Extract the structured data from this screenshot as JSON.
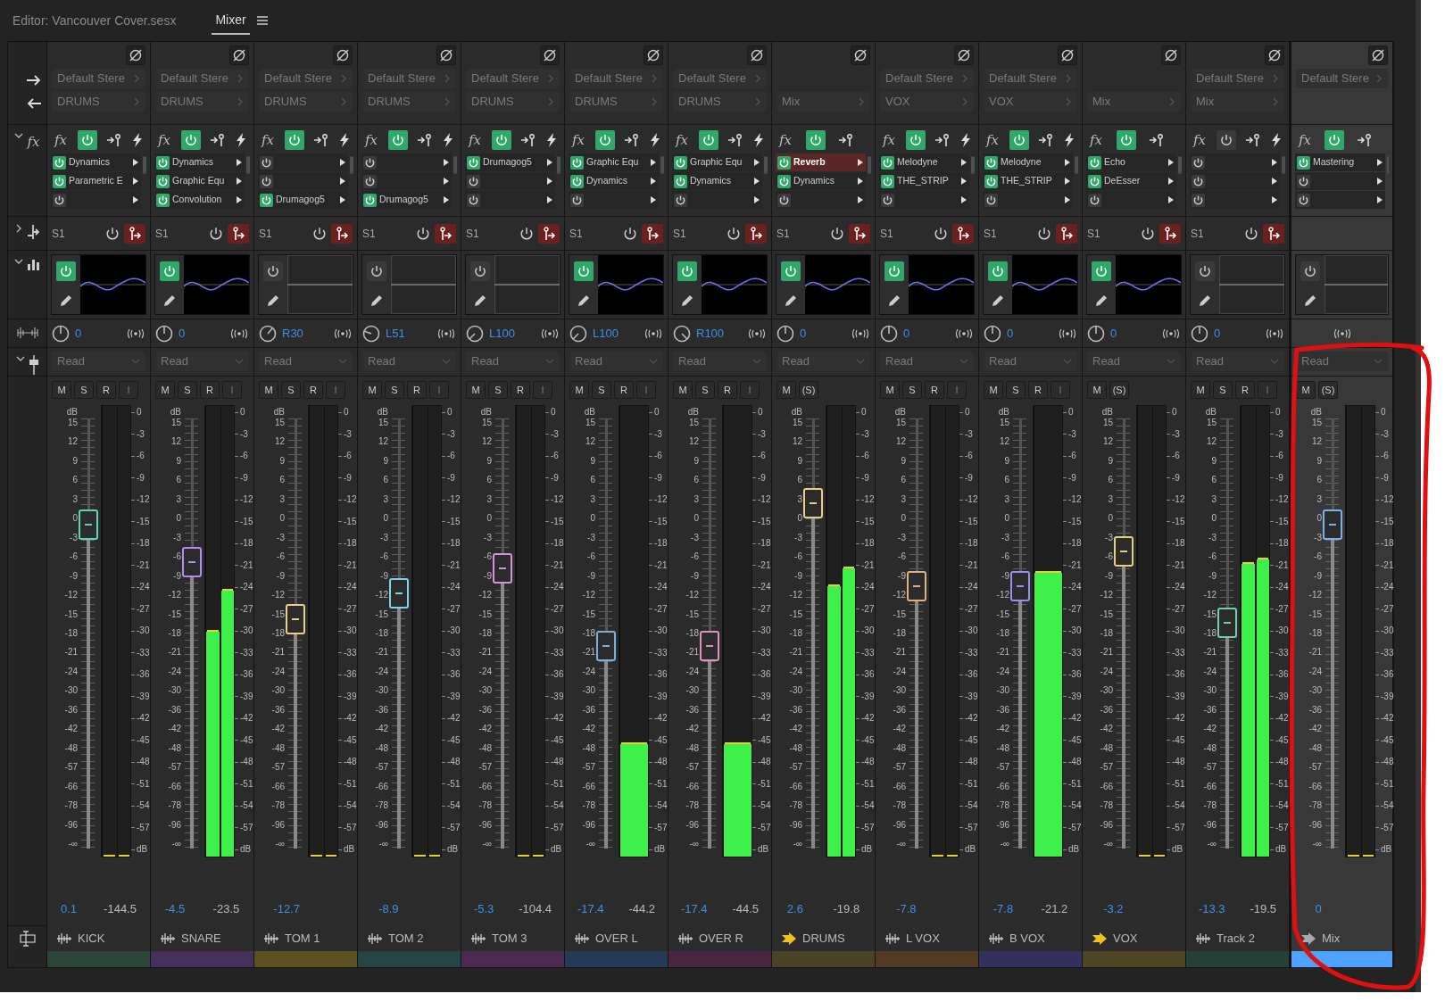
{
  "header": {
    "title": "Editor: Vancouver Cover.sesx",
    "tabs": [
      {
        "label": "Mixer",
        "selected": true
      }
    ]
  },
  "side_labels": {
    "fx": "fx"
  },
  "strips": [
    {
      "kind": "track",
      "input": "Default Stere",
      "output": "DRUMS",
      "fx_label": "fx",
      "fx_on": true,
      "fx_lightning": true,
      "fx": [
        {
          "name": "Dynamics",
          "on": true,
          "selected": false
        },
        {
          "name": "Parametric E",
          "on": true,
          "selected": false
        },
        {
          "on": false,
          "selected": false
        }
      ],
      "send": "S1",
      "eq_on": true,
      "pan": {
        "value": "0",
        "kind": "center"
      },
      "automation": "Read",
      "buttons": [
        {
          "label": "M",
          "disabled": false
        },
        {
          "label": "S",
          "disabled": false
        },
        {
          "label": "R",
          "disabled": false
        },
        {
          "label": "I",
          "disabled": true
        }
      ],
      "fader_scale": [
        "15",
        "12",
        "9",
        "6",
        "3",
        "0",
        "-3",
        "-6",
        "-9",
        "-12",
        "-15",
        "-18",
        "-21",
        "-24",
        "-30",
        "-36",
        "-42",
        "-48",
        "-57",
        "-66",
        "-78",
        "-96",
        "-∞"
      ],
      "fader_unit": "dB",
      "meter_unit": "dB",
      "fader": {
        "level": 0.754,
        "color": "#5fd3b5"
      },
      "meters": [
        {
          "level": 0
        },
        {
          "level": 0
        }
      ],
      "meter_scale": [
        "0",
        "-3",
        "-6",
        "-9",
        "-12",
        "-15",
        "-18",
        "-21",
        "-24",
        "-27",
        "-30",
        "-33",
        "-36",
        "-39",
        "-42",
        "-45",
        "-48",
        "-51",
        "-54",
        "-57"
      ],
      "volume": "0.1",
      "peak": "-144.5",
      "name": "KICK",
      "color": "#2c4538"
    },
    {
      "kind": "track",
      "input": "Default Stere",
      "output": "DRUMS",
      "fx_label": "fx",
      "fx_on": true,
      "fx_lightning": true,
      "fx": [
        {
          "name": "Dynamics",
          "on": true,
          "selected": false
        },
        {
          "name": "Graphic Equ",
          "on": true,
          "selected": false
        },
        {
          "name": "Convolution",
          "on": true,
          "selected": false
        }
      ],
      "send": "S1",
      "eq_on": true,
      "pan": {
        "value": "0",
        "kind": "center"
      },
      "automation": "Read",
      "buttons": [
        {
          "label": "M",
          "disabled": false
        },
        {
          "label": "S",
          "disabled": false
        },
        {
          "label": "R",
          "disabled": false
        },
        {
          "label": "I",
          "disabled": true
        }
      ],
      "fader_scale": [
        "15",
        "12",
        "9",
        "6",
        "3",
        "0",
        "-3",
        "-6",
        "-9",
        "-12",
        "-15",
        "-18",
        "-21",
        "-24",
        "-30",
        "-36",
        "-42",
        "-48",
        "-57",
        "-66",
        "-78",
        "-96",
        "-∞"
      ],
      "fader_unit": "dB",
      "meter_unit": "dB",
      "fader": {
        "level": 0.666,
        "color": "#b48cf0"
      },
      "meters": [
        {
          "level": 0.5
        },
        {
          "level": 0.59
        }
      ],
      "meter_scale": [
        "0",
        "-3",
        "-6",
        "-9",
        "-12",
        "-15",
        "-18",
        "-21",
        "-24",
        "-27",
        "-30",
        "-33",
        "-36",
        "-39",
        "-42",
        "-45",
        "-48",
        "-51",
        "-54",
        "-57"
      ],
      "volume": "-4.5",
      "peak": "-23.5",
      "name": "SNARE",
      "color": "#44305a"
    },
    {
      "kind": "track",
      "input": "Default Stere",
      "output": "DRUMS",
      "fx_label": "fx",
      "fx_on": true,
      "fx_lightning": true,
      "fx": [
        {
          "on": false,
          "selected": false
        },
        {
          "on": false,
          "selected": false
        },
        {
          "name": "Drumagog5",
          "on": true,
          "selected": false
        }
      ],
      "send": "S1",
      "eq_on": false,
      "pan": {
        "value": "R30",
        "kind": "right"
      },
      "automation": "Read",
      "buttons": [
        {
          "label": "M",
          "disabled": false
        },
        {
          "label": "S",
          "disabled": false
        },
        {
          "label": "R",
          "disabled": false
        },
        {
          "label": "I",
          "disabled": true
        }
      ],
      "fader_scale": [
        "15",
        "12",
        "9",
        "6",
        "3",
        "0",
        "-3",
        "-6",
        "-9",
        "-12",
        "-15",
        "-18",
        "-21",
        "-24",
        "-30",
        "-36",
        "-42",
        "-48",
        "-57",
        "-66",
        "-78",
        "-96",
        "-∞"
      ],
      "fader_unit": "dB",
      "meter_unit": "dB",
      "fader": {
        "level": 0.534,
        "color": "#e8d08a"
      },
      "meters": [
        {
          "level": 0
        },
        {
          "level": 0
        }
      ],
      "meter_scale": [
        "0",
        "-3",
        "-6",
        "-9",
        "-12",
        "-15",
        "-18",
        "-21",
        "-24",
        "-27",
        "-30",
        "-33",
        "-36",
        "-39",
        "-42",
        "-45",
        "-48",
        "-51",
        "-54",
        "-57"
      ],
      "volume": "-12.7",
      "name": "TOM 1",
      "color": "#5a5020"
    },
    {
      "kind": "track",
      "input": "Default Stere",
      "output": "DRUMS",
      "fx_label": "fx",
      "fx_on": true,
      "fx_lightning": true,
      "fx": [
        {
          "on": false,
          "selected": false
        },
        {
          "on": false,
          "selected": false
        },
        {
          "name": "Drumagog5",
          "on": true,
          "selected": false
        }
      ],
      "send": "S1",
      "eq_on": false,
      "pan": {
        "value": "L51",
        "kind": "left"
      },
      "automation": "Read",
      "buttons": [
        {
          "label": "M",
          "disabled": false
        },
        {
          "label": "S",
          "disabled": false
        },
        {
          "label": "R",
          "disabled": false
        },
        {
          "label": "I",
          "disabled": true
        }
      ],
      "fader_scale": [
        "15",
        "12",
        "9",
        "6",
        "3",
        "0",
        "-3",
        "-6",
        "-9",
        "-12",
        "-15",
        "-18",
        "-21",
        "-24",
        "-30",
        "-36",
        "-42",
        "-48",
        "-57",
        "-66",
        "-78",
        "-96",
        "-∞"
      ],
      "fader_unit": "dB",
      "meter_unit": "dB",
      "fader": {
        "level": 0.593,
        "color": "#7fd6e0"
      },
      "meters": [
        {
          "level": 0
        },
        {
          "level": 0
        }
      ],
      "meter_scale": [
        "0",
        "-3",
        "-6",
        "-9",
        "-12",
        "-15",
        "-18",
        "-21",
        "-24",
        "-27",
        "-30",
        "-33",
        "-36",
        "-39",
        "-42",
        "-45",
        "-48",
        "-51",
        "-54",
        "-57"
      ],
      "volume": "-8.9",
      "name": "TOM 2",
      "color": "#254545"
    },
    {
      "kind": "track",
      "input": "Default Stere",
      "output": "DRUMS",
      "fx_label": "fx",
      "fx_on": true,
      "fx_lightning": true,
      "fx": [
        {
          "name": "Drumagog5",
          "on": true,
          "selected": false
        },
        {
          "on": false,
          "selected": false
        },
        {
          "on": false,
          "selected": false
        }
      ],
      "send": "S1",
      "eq_on": false,
      "pan": {
        "value": "L100",
        "kind": "hardleft"
      },
      "automation": "Read",
      "buttons": [
        {
          "label": "M",
          "disabled": false
        },
        {
          "label": "S",
          "disabled": false
        },
        {
          "label": "R",
          "disabled": false
        },
        {
          "label": "I",
          "disabled": true
        }
      ],
      "fader_scale": [
        "15",
        "12",
        "9",
        "6",
        "3",
        "0",
        "-3",
        "-6",
        "-9",
        "-12",
        "-15",
        "-18",
        "-21",
        "-24",
        "-30",
        "-36",
        "-42",
        "-48",
        "-57",
        "-66",
        "-78",
        "-96",
        "-∞"
      ],
      "fader_unit": "dB",
      "meter_unit": "dB",
      "fader": {
        "level": 0.651,
        "color": "#d98ee0"
      },
      "meters": [
        {
          "level": 0
        },
        {
          "level": 0
        }
      ],
      "meter_scale": [
        "0",
        "-3",
        "-6",
        "-9",
        "-12",
        "-15",
        "-18",
        "-21",
        "-24",
        "-27",
        "-30",
        "-33",
        "-36",
        "-39",
        "-42",
        "-45",
        "-48",
        "-51",
        "-54",
        "-57"
      ],
      "volume": "-5.3",
      "peak": "-104.4",
      "name": "TOM 3",
      "color": "#4a2a50"
    },
    {
      "kind": "track",
      "input": "Default Stere",
      "output": "DRUMS",
      "fx_label": "fx",
      "fx_on": true,
      "fx_lightning": true,
      "fx": [
        {
          "name": "Graphic Equ",
          "on": true,
          "selected": false
        },
        {
          "name": "Dynamics",
          "on": true,
          "selected": false
        },
        {
          "on": false,
          "selected": false
        }
      ],
      "send": "S1",
      "eq_on": true,
      "pan": {
        "value": "L100",
        "kind": "hardleft"
      },
      "automation": "Read",
      "buttons": [
        {
          "label": "M",
          "disabled": false
        },
        {
          "label": "S",
          "disabled": false
        },
        {
          "label": "R",
          "disabled": false
        },
        {
          "label": "I",
          "disabled": true
        }
      ],
      "fader_scale": [
        "15",
        "12",
        "9",
        "6",
        "3",
        "0",
        "-3",
        "-6",
        "-9",
        "-12",
        "-15",
        "-18",
        "-21",
        "-24",
        "-30",
        "-36",
        "-42",
        "-48",
        "-57",
        "-66",
        "-78",
        "-96",
        "-∞"
      ],
      "fader_unit": "dB",
      "meter_unit": "dB",
      "fader": {
        "level": 0.472,
        "color": "#7aaee0"
      },
      "meters": [
        {
          "level": 0.25
        }
      ],
      "meter_scale": [
        "0",
        "-3",
        "-6",
        "-9",
        "-12",
        "-15",
        "-18",
        "-21",
        "-24",
        "-27",
        "-30",
        "-33",
        "-36",
        "-39",
        "-42",
        "-45",
        "-48",
        "-51",
        "-54",
        "-57"
      ],
      "volume": "-17.4",
      "peak": "-44.2",
      "name": "OVER L",
      "color": "#263a58"
    },
    {
      "kind": "track",
      "input": "Default Stere",
      "output": "DRUMS",
      "fx_label": "fx",
      "fx_on": true,
      "fx_lightning": true,
      "fx": [
        {
          "name": "Graphic Equ",
          "on": true,
          "selected": false
        },
        {
          "name": "Dynamics",
          "on": true,
          "selected": false
        },
        {
          "on": false,
          "selected": false
        }
      ],
      "send": "S1",
      "eq_on": true,
      "pan": {
        "value": "R100",
        "kind": "hardright"
      },
      "automation": "Read",
      "buttons": [
        {
          "label": "M",
          "disabled": false
        },
        {
          "label": "S",
          "disabled": false
        },
        {
          "label": "R",
          "disabled": false
        },
        {
          "label": "I",
          "disabled": true
        }
      ],
      "fader_scale": [
        "15",
        "12",
        "9",
        "6",
        "3",
        "0",
        "-3",
        "-6",
        "-9",
        "-12",
        "-15",
        "-18",
        "-21",
        "-24",
        "-30",
        "-36",
        "-42",
        "-48",
        "-57",
        "-66",
        "-78",
        "-96",
        "-∞"
      ],
      "fader_unit": "dB",
      "meter_unit": "dB",
      "fader": {
        "level": 0.472,
        "color": "#e090c0"
      },
      "meters": [
        {
          "level": 0.25
        }
      ],
      "meter_scale": [
        "0",
        "-3",
        "-6",
        "-9",
        "-12",
        "-15",
        "-18",
        "-21",
        "-24",
        "-27",
        "-30",
        "-33",
        "-36",
        "-39",
        "-42",
        "-45",
        "-48",
        "-51",
        "-54",
        "-57"
      ],
      "volume": "-17.4",
      "peak": "-44.5",
      "name": "OVER R",
      "color": "#4a2540"
    },
    {
      "kind": "bus",
      "output": "Mix",
      "fx_label": "fx",
      "fx_on": true,
      "fx_lightning": false,
      "fx": [
        {
          "name": "Reverb",
          "on": true,
          "selected": true
        },
        {
          "name": "Dynamics",
          "on": true,
          "selected": false
        },
        {
          "on": false,
          "selected": false
        }
      ],
      "send": "S1",
      "eq_on": true,
      "pan": {
        "value": "0",
        "kind": "center"
      },
      "automation": "Read",
      "buttons": [
        {
          "label": "M",
          "disabled": false
        },
        {
          "label": "(S)",
          "disabled": false
        }
      ],
      "fader_scale": [
        "15",
        "12",
        "9",
        "6",
        "3",
        "0",
        "-3",
        "-6",
        "-9",
        "-12",
        "-15",
        "-18",
        "-21",
        "-24",
        "-30",
        "-36",
        "-42",
        "-48",
        "-57",
        "-66",
        "-78",
        "-96",
        "-∞"
      ],
      "fader_unit": "dB",
      "meter_unit": "dB",
      "fader": {
        "level": 0.802,
        "color": "#e8d08a"
      },
      "meters": [
        {
          "level": 0.6
        },
        {
          "level": 0.64
        }
      ],
      "meter_scale": [
        "0",
        "-3",
        "-6",
        "-9",
        "-12",
        "-15",
        "-18",
        "-21",
        "-24",
        "-27",
        "-30",
        "-33",
        "-36",
        "-39",
        "-42",
        "-45",
        "-48",
        "-51",
        "-54",
        "-57"
      ],
      "volume": "2.6",
      "peak": "-19.8",
      "name": "DRUMS",
      "color": "#4a4225"
    },
    {
      "kind": "track",
      "input": "Default Stere",
      "output": "VOX",
      "fx_label": "fx",
      "fx_on": true,
      "fx_lightning": true,
      "fx": [
        {
          "name": "Melodyne",
          "on": true,
          "selected": false
        },
        {
          "name": "THE_STRIP",
          "on": true,
          "selected": false
        },
        {
          "on": false,
          "selected": false
        }
      ],
      "send": "S1",
      "eq_on": true,
      "pan": {
        "value": "0",
        "kind": "center"
      },
      "automation": "Read",
      "buttons": [
        {
          "label": "M",
          "disabled": false
        },
        {
          "label": "S",
          "disabled": false
        },
        {
          "label": "R",
          "disabled": false
        },
        {
          "label": "I",
          "disabled": true
        }
      ],
      "fader_scale": [
        "15",
        "12",
        "9",
        "6",
        "3",
        "0",
        "-3",
        "-6",
        "-9",
        "-12",
        "-15",
        "-18",
        "-21",
        "-24",
        "-30",
        "-36",
        "-42",
        "-48",
        "-57",
        "-66",
        "-78",
        "-96",
        "-∞"
      ],
      "fader_unit": "dB",
      "meter_unit": "dB",
      "fader": {
        "level": 0.61,
        "color": "#e0b080"
      },
      "meters": [
        {
          "level": 0
        },
        {
          "level": 0
        }
      ],
      "meter_scale": [
        "0",
        "-3",
        "-6",
        "-9",
        "-12",
        "-15",
        "-18",
        "-21",
        "-24",
        "-27",
        "-30",
        "-33",
        "-36",
        "-39",
        "-42",
        "-45",
        "-48",
        "-51",
        "-54",
        "-57"
      ],
      "volume": "-7.8",
      "name": "L VOX",
      "color": "#543a22"
    },
    {
      "kind": "track",
      "input": "Default Stere",
      "output": "VOX",
      "fx_label": "fx",
      "fx_on": true,
      "fx_lightning": true,
      "fx": [
        {
          "name": "Melodyne",
          "on": true,
          "selected": false
        },
        {
          "name": "THE_STRIP",
          "on": true,
          "selected": false
        },
        {
          "on": false,
          "selected": false
        }
      ],
      "send": "S1",
      "eq_on": true,
      "pan": {
        "value": "0",
        "kind": "center"
      },
      "automation": "Read",
      "buttons": [
        {
          "label": "M",
          "disabled": false
        },
        {
          "label": "S",
          "disabled": false
        },
        {
          "label": "R",
          "disabled": false
        },
        {
          "label": "I",
          "disabled": true
        }
      ],
      "fader_scale": [
        "15",
        "12",
        "9",
        "6",
        "3",
        "0",
        "-3",
        "-6",
        "-9",
        "-12",
        "-15",
        "-18",
        "-21",
        "-24",
        "-30",
        "-36",
        "-42",
        "-48",
        "-57",
        "-66",
        "-78",
        "-96",
        "-∞"
      ],
      "fader_unit": "dB",
      "meter_unit": "dB",
      "fader": {
        "level": 0.61,
        "color": "#9a8ef0"
      },
      "meters": [
        {
          "level": 0.63
        }
      ],
      "meter_scale": [
        "0",
        "-3",
        "-6",
        "-9",
        "-12",
        "-15",
        "-18",
        "-21",
        "-24",
        "-27",
        "-30",
        "-33",
        "-36",
        "-39",
        "-42",
        "-45",
        "-48",
        "-51",
        "-54",
        "-57"
      ],
      "volume": "-7.8",
      "peak": "-21.2",
      "name": "B VOX",
      "color": "#33305e"
    },
    {
      "kind": "bus",
      "output": "Mix",
      "fx_label": "fx",
      "fx_on": true,
      "fx_lightning": false,
      "fx": [
        {
          "name": "Echo",
          "on": true,
          "selected": false
        },
        {
          "name": "DeEsser",
          "on": true,
          "selected": false
        },
        {
          "on": false,
          "selected": false
        }
      ],
      "send": "S1",
      "eq_on": true,
      "pan": {
        "value": "0",
        "kind": "center"
      },
      "automation": "Read",
      "buttons": [
        {
          "label": "M",
          "disabled": false
        },
        {
          "label": "(S)",
          "disabled": false
        }
      ],
      "fader_scale": [
        "15",
        "12",
        "9",
        "6",
        "3",
        "0",
        "-3",
        "-6",
        "-9",
        "-12",
        "-15",
        "-18",
        "-21",
        "-24",
        "-30",
        "-36",
        "-42",
        "-48",
        "-57",
        "-66",
        "-78",
        "-96",
        "-∞"
      ],
      "fader_unit": "dB",
      "meter_unit": "dB",
      "fader": {
        "level": 0.691,
        "color": "#e0d080"
      },
      "meters": [
        {
          "level": 0
        },
        {
          "level": 0
        }
      ],
      "meter_scale": [
        "0",
        "-3",
        "-6",
        "-9",
        "-12",
        "-15",
        "-18",
        "-21",
        "-24",
        "-27",
        "-30",
        "-33",
        "-36",
        "-39",
        "-42",
        "-45",
        "-48",
        "-51",
        "-54",
        "-57"
      ],
      "volume": "-3.2",
      "name": "VOX",
      "color": "#4e4522"
    },
    {
      "kind": "track",
      "input": "Default Stere",
      "output": "Mix",
      "fx_label": "fx",
      "fx_on": false,
      "fx_lightning": true,
      "fx": [
        {
          "on": false,
          "selected": false
        },
        {
          "on": false,
          "selected": false
        },
        {
          "on": false,
          "selected": false
        }
      ],
      "send": "S1",
      "eq_on": false,
      "pan": {
        "value": "0",
        "kind": "center"
      },
      "automation": "Read",
      "buttons": [
        {
          "label": "M",
          "disabled": false
        },
        {
          "label": "S",
          "disabled": false
        },
        {
          "label": "R",
          "disabled": false
        },
        {
          "label": "I",
          "disabled": true
        }
      ],
      "fader_scale": [
        "15",
        "12",
        "9",
        "6",
        "3",
        "0",
        "-3",
        "-6",
        "-9",
        "-12",
        "-15",
        "-18",
        "-21",
        "-24",
        "-30",
        "-36",
        "-42",
        "-48",
        "-57",
        "-66",
        "-78",
        "-96",
        "-∞"
      ],
      "fader_unit": "dB",
      "meter_unit": "dB",
      "fader": {
        "level": 0.524,
        "color": "#6fd0b0"
      },
      "meters": [
        {
          "level": 0.65
        },
        {
          "level": 0.66
        }
      ],
      "meter_scale": [
        "0",
        "-3",
        "-6",
        "-9",
        "-12",
        "-15",
        "-18",
        "-21",
        "-24",
        "-27",
        "-30",
        "-33",
        "-36",
        "-39",
        "-42",
        "-45",
        "-48",
        "-51",
        "-54",
        "-57"
      ],
      "volume": "-13.3",
      "peak": "-19.5",
      "name": "Track 2",
      "color": "#264038"
    },
    {
      "kind": "master",
      "output": "Default Stere",
      "fx_label": "fx",
      "fx_on": true,
      "fx_lightning": false,
      "fx": [
        {
          "name": "Mastering",
          "on": true,
          "selected": false
        },
        {
          "on": false,
          "selected": false
        },
        {
          "on": false,
          "selected": false
        }
      ],
      "eq_on": false,
      "automation": "Read",
      "buttons": [
        {
          "label": "M",
          "disabled": false
        },
        {
          "label": "(S)",
          "disabled": false
        }
      ],
      "fader_scale": [
        "15",
        "12",
        "9",
        "6",
        "3",
        "0",
        "-3",
        "-6",
        "-9",
        "-12",
        "-15",
        "-18",
        "-21",
        "-24",
        "-30",
        "-36",
        "-42",
        "-48",
        "-57",
        "-66",
        "-78",
        "-96",
        "-∞"
      ],
      "fader_unit": "dB",
      "meter_unit": "dB",
      "fader": {
        "level": 0.754,
        "color": "#7ab0f0"
      },
      "meters": [
        {
          "level": 0
        },
        {
          "level": 0
        }
      ],
      "meter_scale": [
        "0",
        "-3",
        "-6",
        "-9",
        "-12",
        "-15",
        "-18",
        "-21",
        "-24",
        "-27",
        "-30",
        "-33",
        "-36",
        "-39",
        "-42",
        "-45",
        "-48",
        "-51",
        "-54",
        "-57"
      ],
      "volume": "0",
      "name": "Mix",
      "color": "#4da3ff"
    }
  ],
  "annotation": {
    "kind": "scribble",
    "color": "#e01010"
  }
}
